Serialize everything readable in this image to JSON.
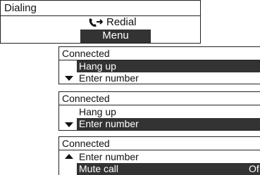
{
  "colors": {
    "highlight": "#333333",
    "highlight_text": "#ffffff",
    "frame": "#222222"
  },
  "screens": [
    {
      "title": "Dialing",
      "redial_label": "Redial",
      "redial_icon": "phone-redial-icon",
      "menu_label": "Menu"
    },
    {
      "title": "Connected",
      "items": [
        {
          "label": "Hang up",
          "selected": true
        },
        {
          "label": "Enter number",
          "selected": false,
          "arrow": "down-arrow-icon"
        }
      ]
    },
    {
      "title": "Connected",
      "items": [
        {
          "label": "Hang up",
          "selected": false
        },
        {
          "label": "Enter number",
          "selected": true,
          "arrow": "down-arrow-icon"
        }
      ]
    },
    {
      "title": "Connected",
      "items": [
        {
          "label": "Enter number",
          "selected": false,
          "arrow": "up-arrow-icon"
        },
        {
          "label": "Mute call",
          "selected": true,
          "value": "Of"
        }
      ]
    }
  ]
}
